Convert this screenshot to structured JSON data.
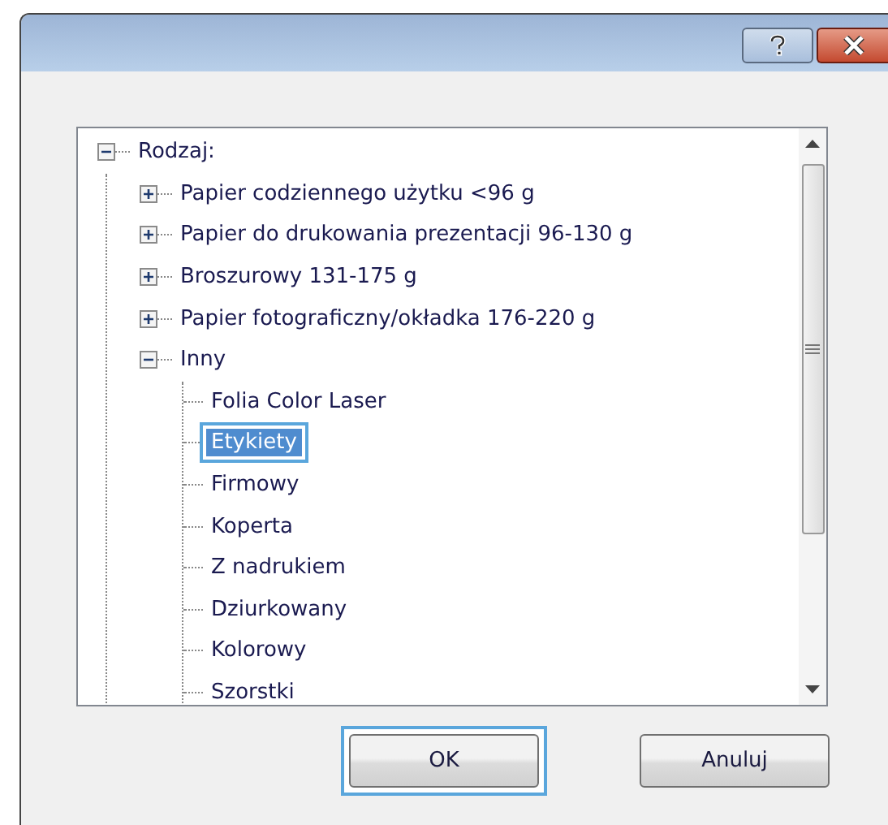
{
  "tree": [
    {
      "label": "Rodzaj:",
      "expanded": true,
      "selected": false,
      "children": [
        {
          "label": "Papier codziennego użytku <96 g",
          "expanded": false,
          "selected": false
        },
        {
          "label": "Papier do drukowania prezentacji 96-130 g",
          "expanded": false,
          "selected": false
        },
        {
          "label": "Broszurowy 131-175 g",
          "expanded": false,
          "selected": false
        },
        {
          "label": "Papier fotograficzny/okładka 176-220 g",
          "expanded": false,
          "selected": false
        },
        {
          "label": "Inny",
          "expanded": true,
          "selected": false,
          "children": [
            {
              "label": "Folia Color Laser",
              "selected": false
            },
            {
              "label": "Etykiety",
              "selected": true
            },
            {
              "label": "Firmowy",
              "selected": false
            },
            {
              "label": "Koperta",
              "selected": false
            },
            {
              "label": "Z nadrukiem",
              "selected": false
            },
            {
              "label": "Dziurkowany",
              "selected": false
            },
            {
              "label": "Kolorowy",
              "selected": false
            },
            {
              "label": "Szorstki",
              "selected": false
            }
          ]
        }
      ]
    }
  ],
  "buttons": [
    {
      "label": "OK",
      "default": true
    },
    {
      "label": "Anuluj",
      "default": false
    }
  ]
}
